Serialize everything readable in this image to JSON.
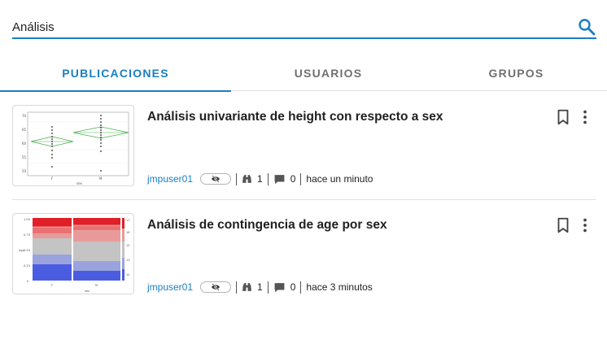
{
  "search": {
    "value": "Análisis",
    "icon": "search-icon"
  },
  "tabs": [
    {
      "label": "PUBLICACIONES",
      "active": true
    },
    {
      "label": "USUARIOS",
      "active": false
    },
    {
      "label": "GRUPOS",
      "active": false
    }
  ],
  "colors": {
    "accent": "#1a7fc1",
    "text": "#212121",
    "muted": "#707070"
  },
  "posts": [
    {
      "title": "Análisis univariante de height con respecto a sex",
      "author": "jmpuser01",
      "likes": "1",
      "comments": "0",
      "time": "hace un minuto",
      "thumbnail": "univariate-chart"
    },
    {
      "title": "Análisis de contingencia de age por sex",
      "author": "jmpuser01",
      "likes": "1",
      "comments": "0",
      "time": "hace 3 minutos",
      "thumbnail": "mosaic-chart"
    }
  ]
}
